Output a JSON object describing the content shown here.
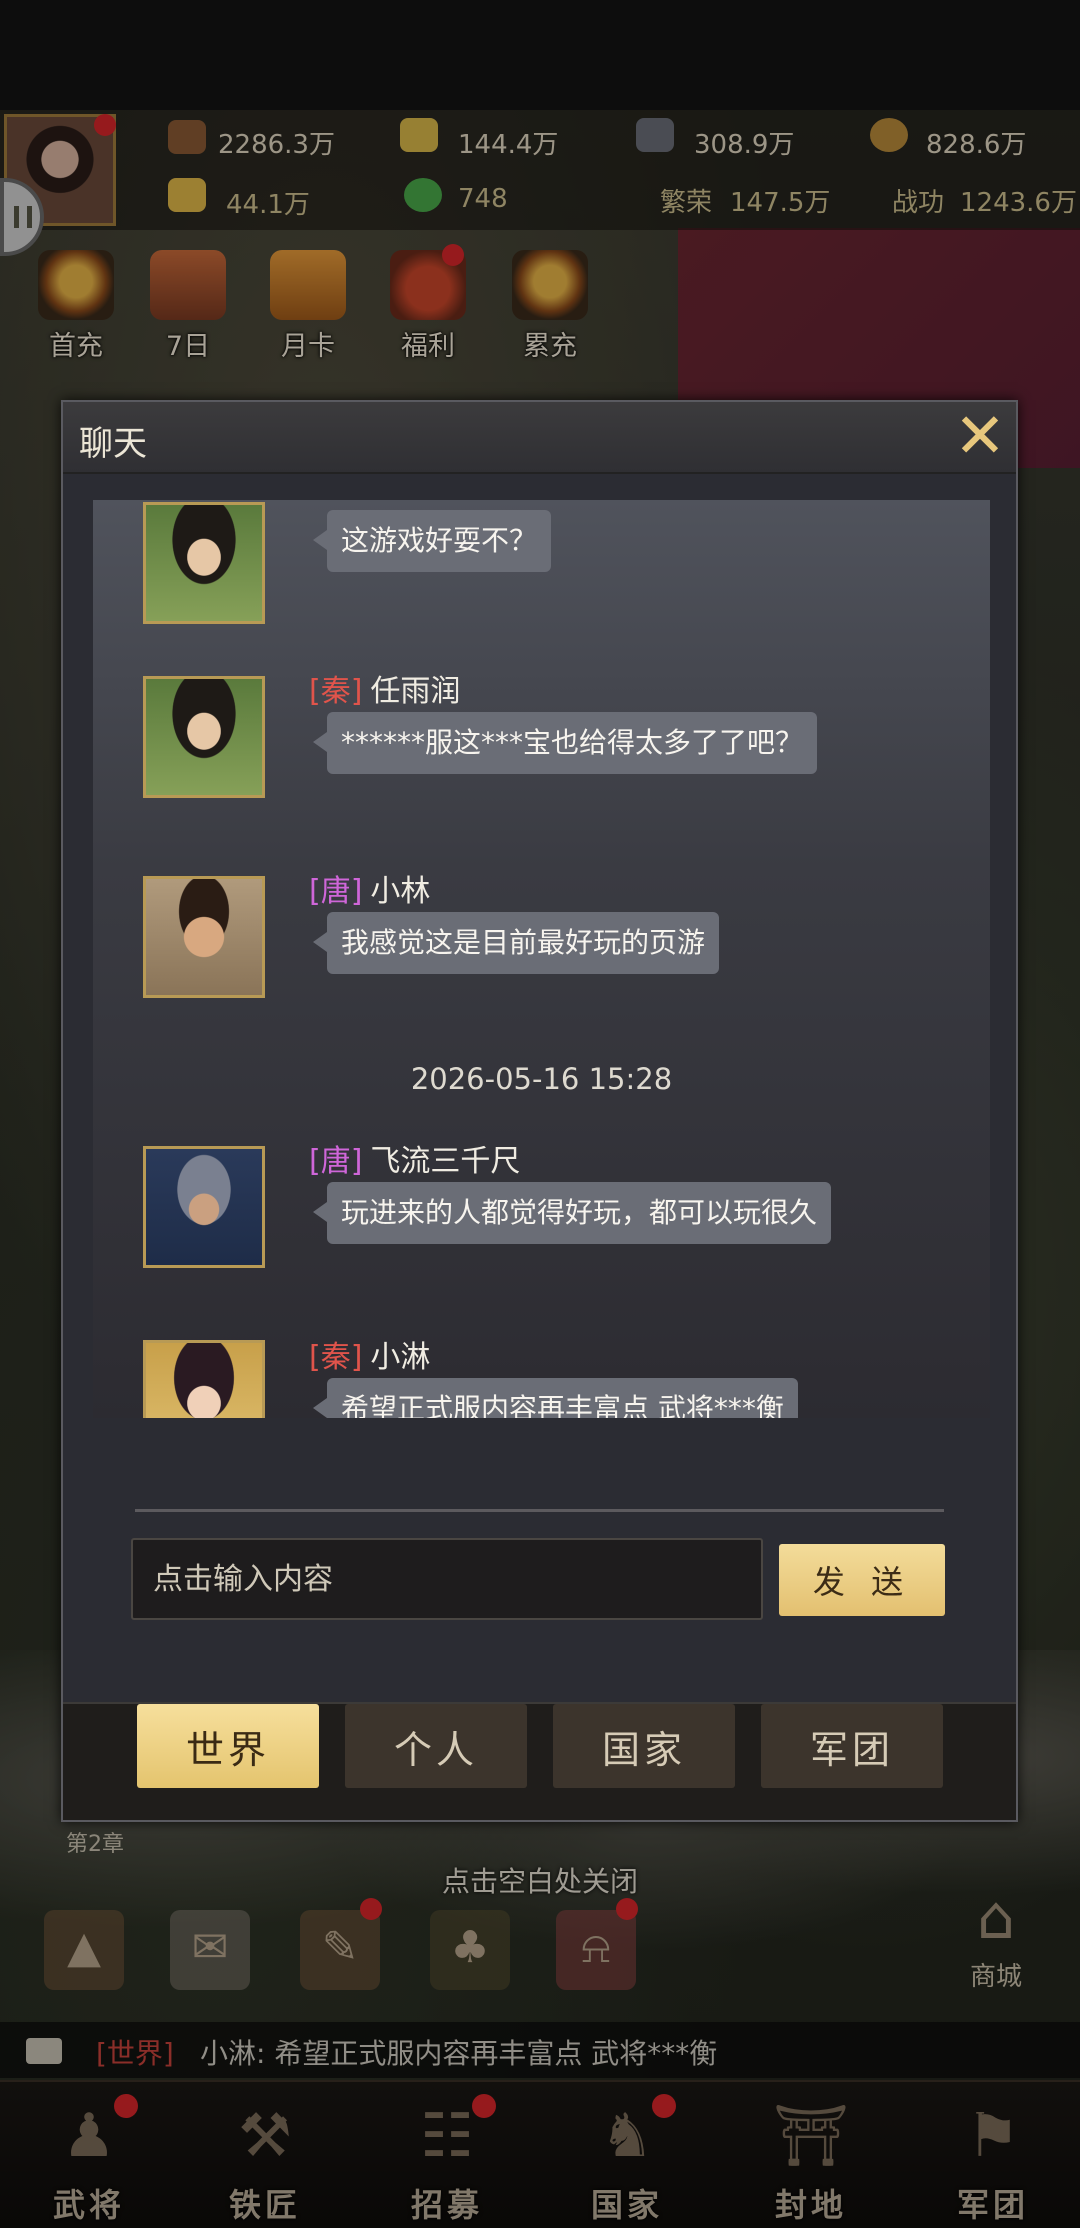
{
  "colors": {
    "accent_gold": "#e4c46e",
    "nation_qin": "#e0544b",
    "nation_tang": "#cf66d9",
    "notify_red": "#d7262a",
    "panel_bg": "#2b2c33"
  },
  "hud": {
    "resources_row1": [
      {
        "icon": "wood-log-icon",
        "value": "2286.3万"
      },
      {
        "icon": "wheat-icon",
        "value": "144.4万"
      },
      {
        "icon": "iron-ore-icon",
        "value": "308.9万"
      },
      {
        "icon": "copper-coin-icon",
        "value": "828.6万"
      }
    ],
    "resources_row2": [
      {
        "icon": "gold-ingot-icon",
        "value": "44.1万"
      },
      {
        "icon": "jade-icon",
        "value": "748"
      }
    ],
    "prosperity": {
      "label": "繁荣",
      "value": "147.5万"
    },
    "merit": {
      "label": "战功",
      "value": "1243.6万"
    },
    "activities": [
      {
        "label": "首充",
        "icon": "first-recharge-icon",
        "dot": false
      },
      {
        "label": "7日",
        "icon": "seven-day-icon",
        "dot": false
      },
      {
        "label": "月卡",
        "icon": "month-card-icon",
        "dot": false
      },
      {
        "label": "福利",
        "icon": "welfare-bag-icon",
        "dot": true
      },
      {
        "label": "累充",
        "icon": "cumulative-recharge-icon",
        "dot": false
      }
    ]
  },
  "chat": {
    "title": "聊天",
    "messages": [
      {
        "nation": "",
        "name": "",
        "text": "这游戏好耍不？",
        "avatar": "green-robed-general-portrait"
      },
      {
        "nation": "[秦]",
        "name": "任雨润",
        "text": "******服这***宝也给得太多了了吧？",
        "avatar": "green-robed-general-portrait"
      },
      {
        "nation": "[唐]",
        "name": "小林",
        "text": "我感觉这是目前最好玩的页游",
        "avatar": "young-man-portrait"
      },
      {
        "nation": "[唐]",
        "name": "飞流三千尺",
        "text": "玩进来的人都觉得好玩，都可以玩很久",
        "avatar": "helmeted-soldier-portrait"
      },
      {
        "nation": "[秦]",
        "name": "小淋",
        "text": "希望正式服内容再丰富点 武将***衡",
        "avatar": "noble-lady-portrait"
      }
    ],
    "timestamp": "2026-05-16  15:28",
    "input_placeholder": "点击输入内容",
    "send_label": "发 送",
    "tabs": [
      {
        "label": "世界",
        "active": true
      },
      {
        "label": "个人",
        "active": false
      },
      {
        "label": "国家",
        "active": false
      },
      {
        "label": "军团",
        "active": false
      }
    ]
  },
  "chapter_label": "第2章",
  "close_hint": "点击空白处关闭",
  "shop_label": "商城",
  "ticker": {
    "channel": "[世界]",
    "text": "小淋: 希望正式服内容再丰富点 武将***衡"
  },
  "bottom_nav": [
    {
      "label": "武将",
      "icon": "general-helmet-icon",
      "dot": true
    },
    {
      "label": "铁匠",
      "icon": "anvil-hammer-icon",
      "dot": false
    },
    {
      "label": "招募",
      "icon": "scroll-icon",
      "dot": true
    },
    {
      "label": "国家",
      "icon": "lion-statue-icon",
      "dot": true
    },
    {
      "label": "封地",
      "icon": "city-gate-icon",
      "dot": false
    },
    {
      "label": "军团",
      "icon": "banner-flag-icon",
      "dot": false
    }
  ]
}
